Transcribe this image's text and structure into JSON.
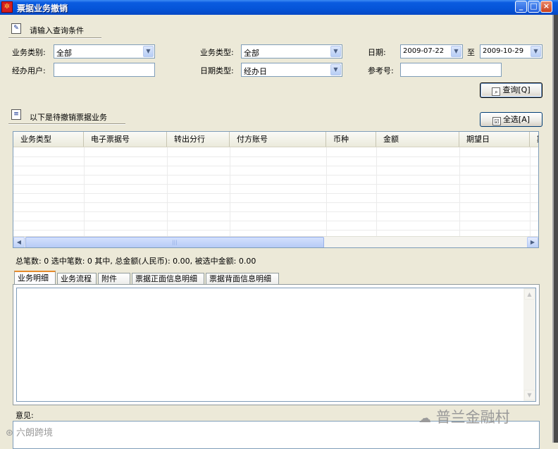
{
  "window": {
    "title": "票据业务撤销",
    "controls": {
      "minimize": "_",
      "maximize": "□",
      "close": "×"
    }
  },
  "query": {
    "section_title": "请输入查询条件",
    "business_category": {
      "label": "业务类别:",
      "value": "全部"
    },
    "business_type": {
      "label": "业务类型:",
      "value": "全部"
    },
    "date": {
      "label": "日期:",
      "from": "2009-07-22",
      "to_label": "至",
      "to": "2009-10-29"
    },
    "handling_user": {
      "label": "经办用户:",
      "value": ""
    },
    "date_type": {
      "label": "日期类型:",
      "value": "经办日"
    },
    "reference_no": {
      "label": "参考号:",
      "value": ""
    },
    "search_button": "查询[Q]"
  },
  "list": {
    "section_title": "以下是待撤销票据业务",
    "select_all_button": "全选[A]",
    "columns": [
      "业务类型",
      "电子票据号",
      "转出分行",
      "付方账号",
      "币种",
      "金额",
      "期望日",
      "期"
    ],
    "rows": []
  },
  "summary": {
    "text": "总笔数: 0  选中笔数: 0  其中, 总金额(人民币): 0.00, 被选中金额: 0.00"
  },
  "tabs": [
    {
      "label": "业务明细",
      "active": true
    },
    {
      "label": "业务流程",
      "active": false
    },
    {
      "label": "附件",
      "active": false
    },
    {
      "label": "票据正面信息明细",
      "active": false
    },
    {
      "label": "票据背面信息明细",
      "active": false
    }
  ],
  "opinion": {
    "label": "意见:"
  },
  "watermarks": {
    "left": "六朗跨境",
    "right": "普兰金融村"
  }
}
